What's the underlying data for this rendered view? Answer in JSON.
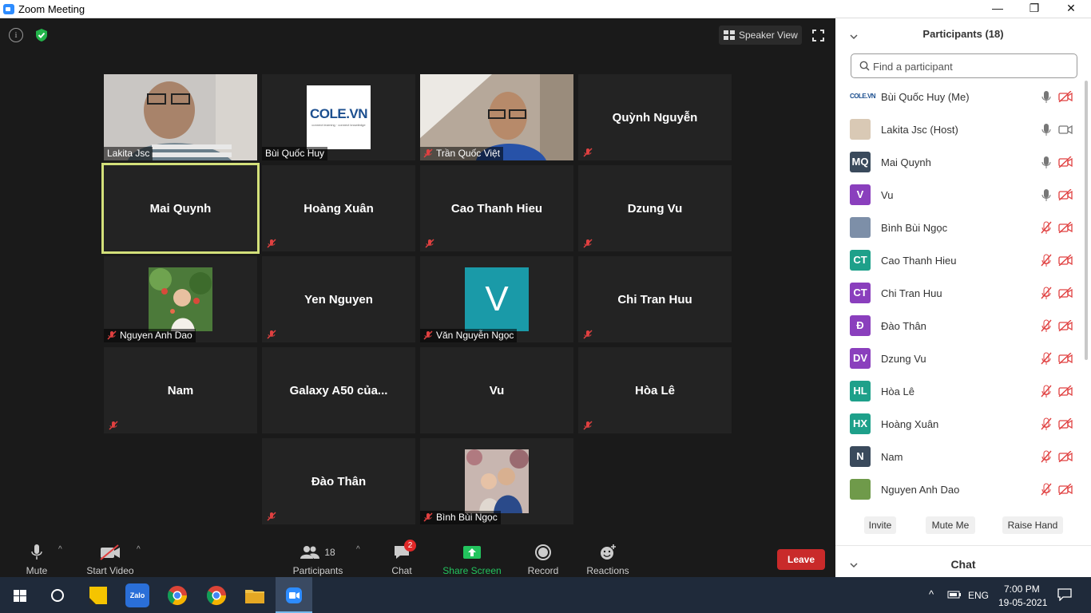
{
  "window": {
    "title": "Zoom Meeting",
    "minimize": "—",
    "maximize": "❐",
    "close": "✕"
  },
  "topbar": {
    "speaker_view": "Speaker View"
  },
  "tiles": [
    {
      "label": "Lakita Jsc",
      "kind": "video1",
      "muted": false
    },
    {
      "label": "Bùi Quốc Huy",
      "kind": "cole",
      "muted": false,
      "logo_text": "COLE.VN",
      "logo_sub": "connect learning · connect knowledge"
    },
    {
      "label": "Trần Quốc Việt",
      "kind": "video2",
      "muted": true
    },
    {
      "center": "Quỳnh Nguyễn",
      "muted": true
    },
    {
      "center": "Mai Quynh",
      "muted": false,
      "active": true
    },
    {
      "center": "Hoàng Xuân",
      "muted": true
    },
    {
      "center": "Cao Thanh Hieu",
      "muted": true
    },
    {
      "center": "Dzung Vu",
      "muted": true
    },
    {
      "label": "Nguyen Anh Dao",
      "kind": "flower",
      "muted": true
    },
    {
      "center": "Yen Nguyen",
      "muted": true
    },
    {
      "label": "Văn Nguyễn Ngọc",
      "kind": "letter",
      "letter": "V",
      "muted": true
    },
    {
      "center": "Chi Tran Huu",
      "muted": true
    },
    {
      "center": "Nam",
      "muted": true
    },
    {
      "center": "Galaxy A50 của...",
      "muted": false
    },
    {
      "center": "Vu",
      "muted": false
    },
    {
      "center": "Hòa Lê",
      "muted": true
    },
    {
      "center": "Đào Thân",
      "muted": true
    },
    {
      "label": "Bình Bùi Ngọc",
      "kind": "couple",
      "muted": true
    }
  ],
  "toolbar": {
    "mute": "Mute",
    "start_video": "Start Video",
    "participants_count": "18",
    "participants": "Participants",
    "chat_badge": "2",
    "chat": "Chat",
    "share_screen": "Share Screen",
    "record": "Record",
    "reactions": "Reactions",
    "leave": "Leave",
    "caret": "^"
  },
  "panel": {
    "title": "Participants (18)",
    "search_placeholder": "Find a participant",
    "participants": [
      {
        "name": "Bùi Quốc Huy (Me)",
        "avatar": "COLE.VN",
        "color": "#ffffff",
        "mic": "on",
        "cam": "off"
      },
      {
        "name": "Lakita Jsc (Host)",
        "avatar": "",
        "color": "#d9c9b5",
        "mic": "on",
        "cam": "on"
      },
      {
        "name": "Mai Quynh",
        "avatar": "MQ",
        "color": "#3a4a5c",
        "mic": "on",
        "cam": "off"
      },
      {
        "name": "Vu",
        "avatar": "V",
        "color": "#8a3fbd",
        "mic": "on",
        "cam": "off"
      },
      {
        "name": "Bình Bùi Ngọc",
        "avatar": "",
        "color": "#7d8fa8",
        "mic": "off",
        "cam": "off"
      },
      {
        "name": "Cao Thanh Hieu",
        "avatar": "CT",
        "color": "#1ea08a",
        "mic": "off",
        "cam": "off"
      },
      {
        "name": "Chi Tran Huu",
        "avatar": "CT",
        "color": "#8a3fbd",
        "mic": "off",
        "cam": "off"
      },
      {
        "name": "Đào Thân",
        "avatar": "Đ",
        "color": "#8a3fbd",
        "mic": "off",
        "cam": "off"
      },
      {
        "name": "Dzung Vu",
        "avatar": "DV",
        "color": "#8a3fbd",
        "mic": "off",
        "cam": "off"
      },
      {
        "name": "Hòa Lê",
        "avatar": "HL",
        "color": "#1ea08a",
        "mic": "off",
        "cam": "off"
      },
      {
        "name": "Hoàng Xuân",
        "avatar": "HX",
        "color": "#1ea08a",
        "mic": "off",
        "cam": "off"
      },
      {
        "name": "Nam",
        "avatar": "N",
        "color": "#3a4a5c",
        "mic": "off",
        "cam": "off"
      },
      {
        "name": "Nguyen Anh Dao",
        "avatar": "",
        "color": "#6f9a4a",
        "mic": "off",
        "cam": "off"
      }
    ],
    "invite": "Invite",
    "mute_me": "Mute Me",
    "raise_hand": "Raise Hand",
    "chat_title": "Chat"
  },
  "taskbar": {
    "lang": "ENG",
    "time": "7:00 PM",
    "date": "19-05-2021",
    "zalo": "Zalo"
  }
}
